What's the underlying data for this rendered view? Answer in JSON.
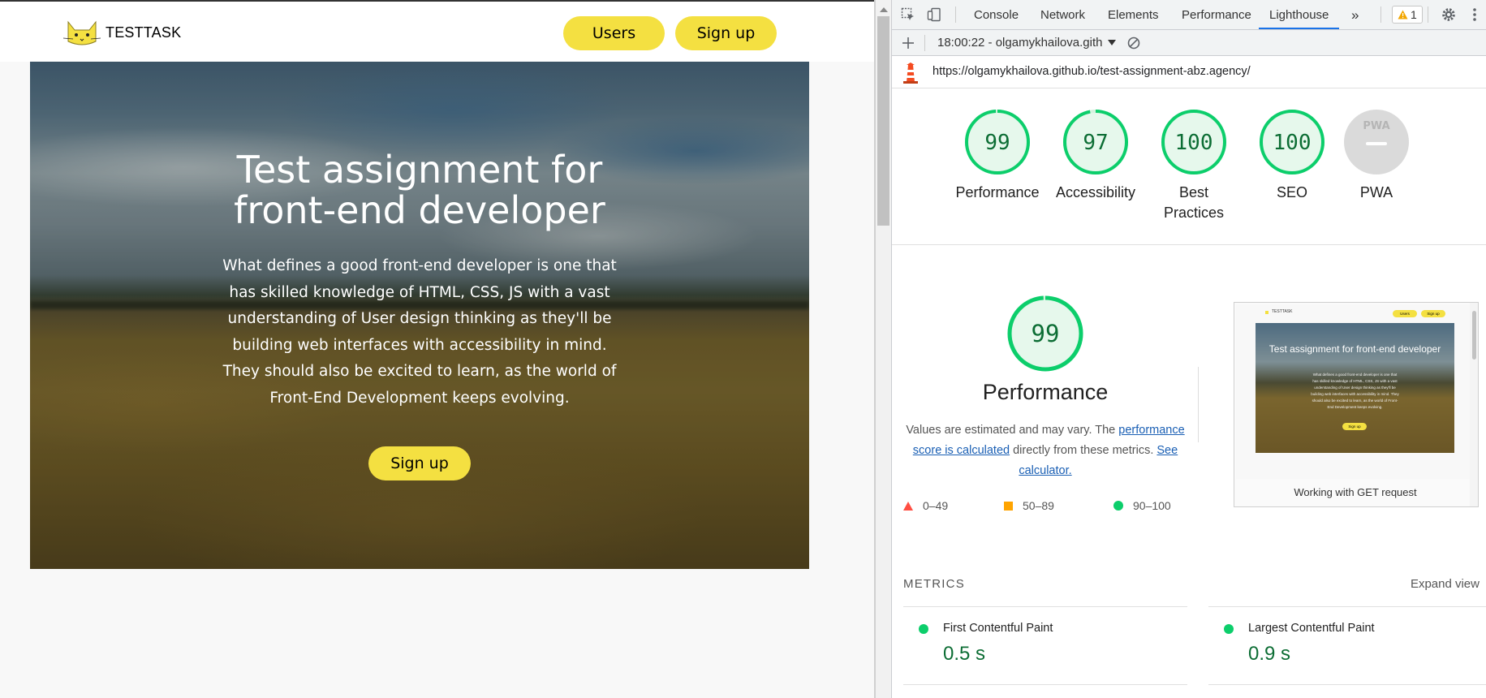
{
  "site": {
    "logo_text": "TESTTASK",
    "nav": {
      "users_label": "Users",
      "signup_label": "Sign up"
    },
    "hero": {
      "title": "Test assignment for front-end developer",
      "text": "What defines a good front-end developer is one that has skilled knowledge of HTML, CSS, JS with a vast understanding of User design thinking as they'll be building web interfaces with accessibility in mind. They should also be excited to learn, as the world of Front-End Development keeps evolving.",
      "button_label": "Sign up"
    },
    "accent": "#f4e041"
  },
  "devtools": {
    "tabs": [
      "Console",
      "Network",
      "Elements",
      "Performance",
      "Lighthouse"
    ],
    "active_tab": "Lighthouse",
    "more_tabs": "»",
    "warnings_count": "1",
    "report_label": "18:00:22 - olgamykhailova.gith",
    "url": "https://olgamykhailova.github.io/test-assignment-abz.agency/",
    "gauges": [
      {
        "score": "99",
        "label": "Performance",
        "fraction": 0.99
      },
      {
        "score": "97",
        "label": "Accessibility",
        "fraction": 0.97
      },
      {
        "score": "100",
        "label": "Best Practices",
        "fraction": 1.0
      },
      {
        "score": "100",
        "label": "SEO",
        "fraction": 1.0
      }
    ],
    "pwa": {
      "label": "PWA",
      "badge": "PWA"
    },
    "performance": {
      "score": "99",
      "title": "Performance",
      "desc_1": "Values are estimated and may vary. The",
      "desc_link_1": "performance score is calculated",
      "desc_2": "directly from these metrics.",
      "desc_link_2": "See calculator."
    },
    "legend": {
      "bad": "0–49",
      "average": "50–89",
      "good": "90–100"
    },
    "thumbnail": {
      "logo": "TESTTASK",
      "users": "Users",
      "signup": "Sign up",
      "title": "Test assignment for front-end developer",
      "text": "What defines a good front-end developer is one that has skilled knowledge of HTML, CSS, JS with a vast understanding of User design thinking as they'll be building web interfaces with accessibility in mind. They should also be excited to learn, as the world of Front-End Development keeps evolving.",
      "hero_button": "Sign up",
      "caption": "Working with GET request"
    },
    "metrics": {
      "title": "METRICS",
      "expand": "Expand view",
      "items": [
        {
          "name": "First Contentful Paint",
          "value": "0.5 s"
        },
        {
          "name": "Largest Contentful Paint",
          "value": "0.9 s"
        }
      ]
    },
    "colors": {
      "pass": "#0cce6b",
      "average": "#ffa400",
      "fail": "#ff4e42",
      "active_tab": "#1a73e8"
    }
  }
}
